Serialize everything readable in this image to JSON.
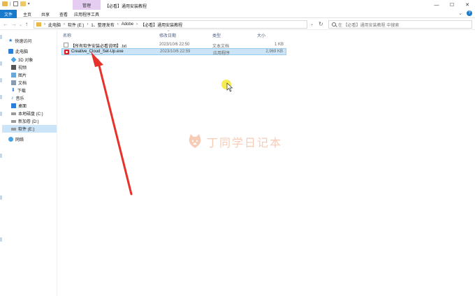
{
  "window": {
    "context_tab": "管理",
    "title": "【必看】通用安装教程",
    "controls": {
      "minimize": "—",
      "maximize": "☐",
      "close": "✕"
    }
  },
  "ribbon": {
    "tabs": [
      "文件",
      "主页",
      "共享",
      "查看",
      "应用程序工具"
    ],
    "expand_glyph": "⌄",
    "help_glyph": "?"
  },
  "nav": {
    "back": "←",
    "forward": "→",
    "recent": "⌄",
    "up": "↑",
    "refresh": "↻",
    "dropdown": "⌄"
  },
  "address": {
    "crumbs": [
      "此电脑",
      "软件 (E:)",
      "1、整理发布",
      "Adobe",
      "【必看】通用安装教程"
    ],
    "separator": "›"
  },
  "search": {
    "placeholder": "在 【必看】通用安装教程 中搜索"
  },
  "sidebar": {
    "items": [
      {
        "label": "快速访问",
        "icon": "star-icon"
      },
      {
        "label": "此电脑",
        "icon": "computer-icon"
      },
      {
        "label": "3D 对象",
        "icon": "cube-icon"
      },
      {
        "label": "视频",
        "icon": "video-icon"
      },
      {
        "label": "图片",
        "icon": "picture-icon"
      },
      {
        "label": "文档",
        "icon": "document-icon"
      },
      {
        "label": "下载",
        "icon": "download-icon"
      },
      {
        "label": "音乐",
        "icon": "music-icon"
      },
      {
        "label": "桌面",
        "icon": "desktop-icon"
      },
      {
        "label": "本地磁盘 (C:)",
        "icon": "drive-icon"
      },
      {
        "label": "新加卷 (D:)",
        "icon": "drive-icon"
      },
      {
        "label": "软件 (E:)",
        "icon": "drive-icon"
      },
      {
        "label": "网络",
        "icon": "network-icon"
      }
    ],
    "selected": "软件 (E:)"
  },
  "columns": {
    "name": "名称",
    "date": "修改日期",
    "type": "类型",
    "size": "大小",
    "sort_glyph": "^"
  },
  "files": [
    {
      "name": "【所有软件安装必看说明】.txt",
      "date": "2023/10/6 22:50",
      "type": "文本文档",
      "size": "1 KB",
      "icon": "text-file-icon",
      "selected": false
    },
    {
      "name": "Creative_Cloud_Set-Up.exe",
      "date": "2023/10/6 22:59",
      "type": "应用程序",
      "size": "2,969 KB",
      "icon": "creative-cloud-exe-icon",
      "selected": true
    }
  ],
  "watermark": {
    "text": "丁同学日记本"
  },
  "colors": {
    "accent": "#1979ca",
    "selection": "#cce4f7",
    "context_tab": "#e4cdf0",
    "annotation_arrow": "#e8312a",
    "cursor_highlight": "#f5e93d"
  }
}
